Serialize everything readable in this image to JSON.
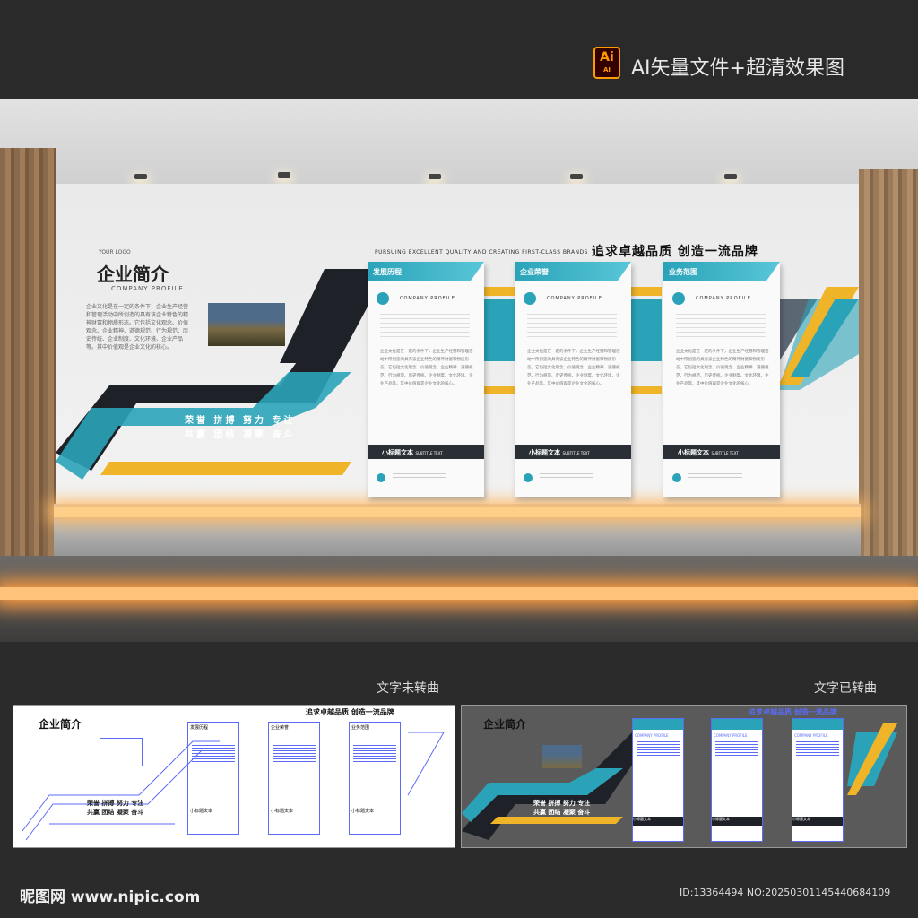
{
  "header": {
    "ai_badge": "Ai",
    "ai_badge_sub": "AI",
    "title": "AI矢量文件+超清效果图"
  },
  "wall": {
    "logo": "YOUR LOGO",
    "title": "企业简介",
    "subtitle": "COMPANY PROFILE",
    "paragraph": "企业文化是在一定的条件下，企业生产经营和管理活动中所创造的具有该企业特色的精神财富和物质形态。它包括文化观念、价值观念、企业精神、道德规范、行为规范、历史传统、企业制度、文化环境、企业产品等。其中价值观是企业文化的核心。",
    "slogan_en": "PURSUING EXCELLENT QUALITY AND CREATING FIRST-CLASS BRANDS",
    "slogan_cn": "追求卓越品质   创造一流品牌",
    "motto_line1": "荣誉  拼搏  努力  专注",
    "motto_line2": "共赢  团结  凝聚  奋斗"
  },
  "panels": [
    {
      "title": "发展历程",
      "profile": "COMPANY  PROFILE",
      "text": "企业文化是在一定的条件下，企业生产经营和管理活动中所创造的具有该企业特色的精神财富和物质形态。它包括文化观念、价值观念、企业精神、道德规范、行为规范、历史传统、企业制度、文化环境、企业产品等。其中价值观是企业文化的核心。",
      "subtitle": "小标题文本",
      "subtitle_en": "SUBTITLE TEXT"
    },
    {
      "title": "企业荣誉",
      "profile": "COMPANY  PROFILE",
      "text": "企业文化是在一定的条件下，企业生产经营和管理活动中所创造的具有该企业特色的精神财富和物质形态。它包括文化观念、价值观念、企业精神、道德规范、行为规范、历史传统、企业制度、文化环境、企业产品等。其中价值观是企业文化的核心。",
      "subtitle": "小标题文本",
      "subtitle_en": "SUBTITLE TEXT"
    },
    {
      "title": "业务范围",
      "profile": "COMPANY  PROFILE",
      "text": "企业文化是在一定的条件下，企业生产经营和管理活动中所创造的具有该企业特色的精神财富和物质形态。它包括文化观念、价值观念、企业精神、道德规范、行为规范、历史传统、企业制度、文化环境、企业产品等。其中价值观是企业文化的核心。",
      "subtitle": "小标题文本",
      "subtitle_en": "SUBTITLE TEXT"
    }
  ],
  "captions": {
    "left": "文字未转曲",
    "right": "文字已转曲"
  },
  "thumb": {
    "title": "企业简介",
    "slogan": "追求卓越品质   创造一流品牌",
    "motto1": "荣誉  拼搏  努力  专注",
    "motto2": "共赢  团结  凝聚  奋斗",
    "profile": "COMPANY  PROFILE",
    "sub": "小标题文本",
    "panel_titles": [
      "发展历程",
      "企业荣誉",
      "业务范围"
    ]
  },
  "footer": {
    "site": "昵图网 www.nipic.com",
    "id": "ID:13364494 NO:20250301145440684109"
  },
  "colors": {
    "teal": "#2aa3b8",
    "black": "#1e2228",
    "yellow": "#f0b429",
    "accent_orange": "#ff9a00",
    "wireframe_blue": "#5b6cf5"
  }
}
